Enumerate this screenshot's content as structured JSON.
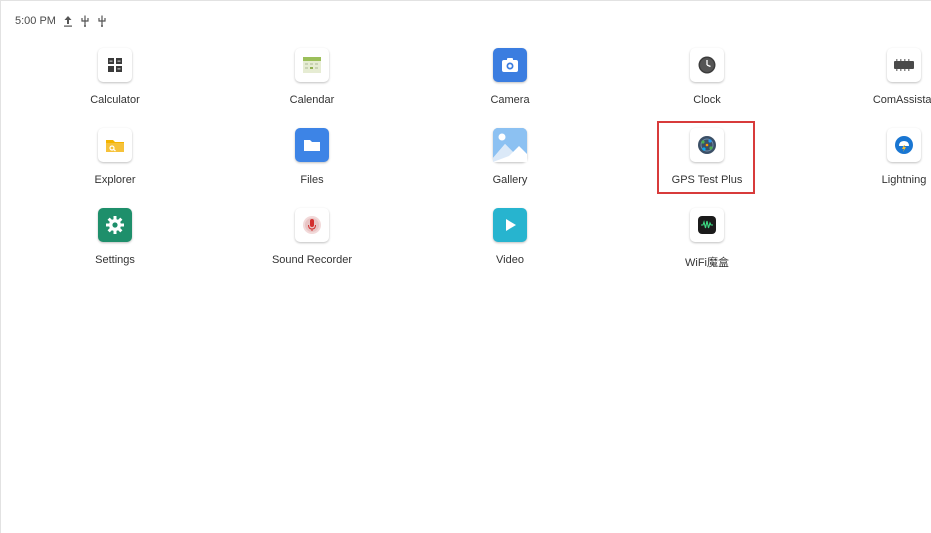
{
  "status_bar": {
    "time": "5:00 PM",
    "icons": [
      "upload-icon",
      "usb-icon",
      "usb-icon"
    ]
  },
  "apps": [
    {
      "label": "Calculator",
      "icon": "calculator-icon"
    },
    {
      "label": "Calendar",
      "icon": "calendar-icon"
    },
    {
      "label": "Camera",
      "icon": "camera-icon"
    },
    {
      "label": "Clock",
      "icon": "clock-icon"
    },
    {
      "label": "ComAssistar",
      "icon": "com-assistant-icon"
    },
    {
      "label": "Explorer",
      "icon": "explorer-folder-icon"
    },
    {
      "label": "Files",
      "icon": "files-folder-icon"
    },
    {
      "label": "Gallery",
      "icon": "gallery-icon"
    },
    {
      "label": "GPS Test Plus",
      "icon": "gps-test-plus-icon"
    },
    {
      "label": "Lightning",
      "icon": "lightning-icon"
    },
    {
      "label": "Settings",
      "icon": "settings-gear-icon"
    },
    {
      "label": "Sound Recorder",
      "icon": "microphone-icon"
    },
    {
      "label": "Video",
      "icon": "video-play-icon"
    },
    {
      "label": "WiFi魔盒",
      "icon": "wifi-box-icon"
    }
  ],
  "colors": {
    "highlight": "#d83b3b",
    "camera": "#3b7de0",
    "files": "#3d84e6",
    "settings": "#1e8f6b",
    "video": "#27b4cf",
    "lightning": "#1976d2"
  }
}
